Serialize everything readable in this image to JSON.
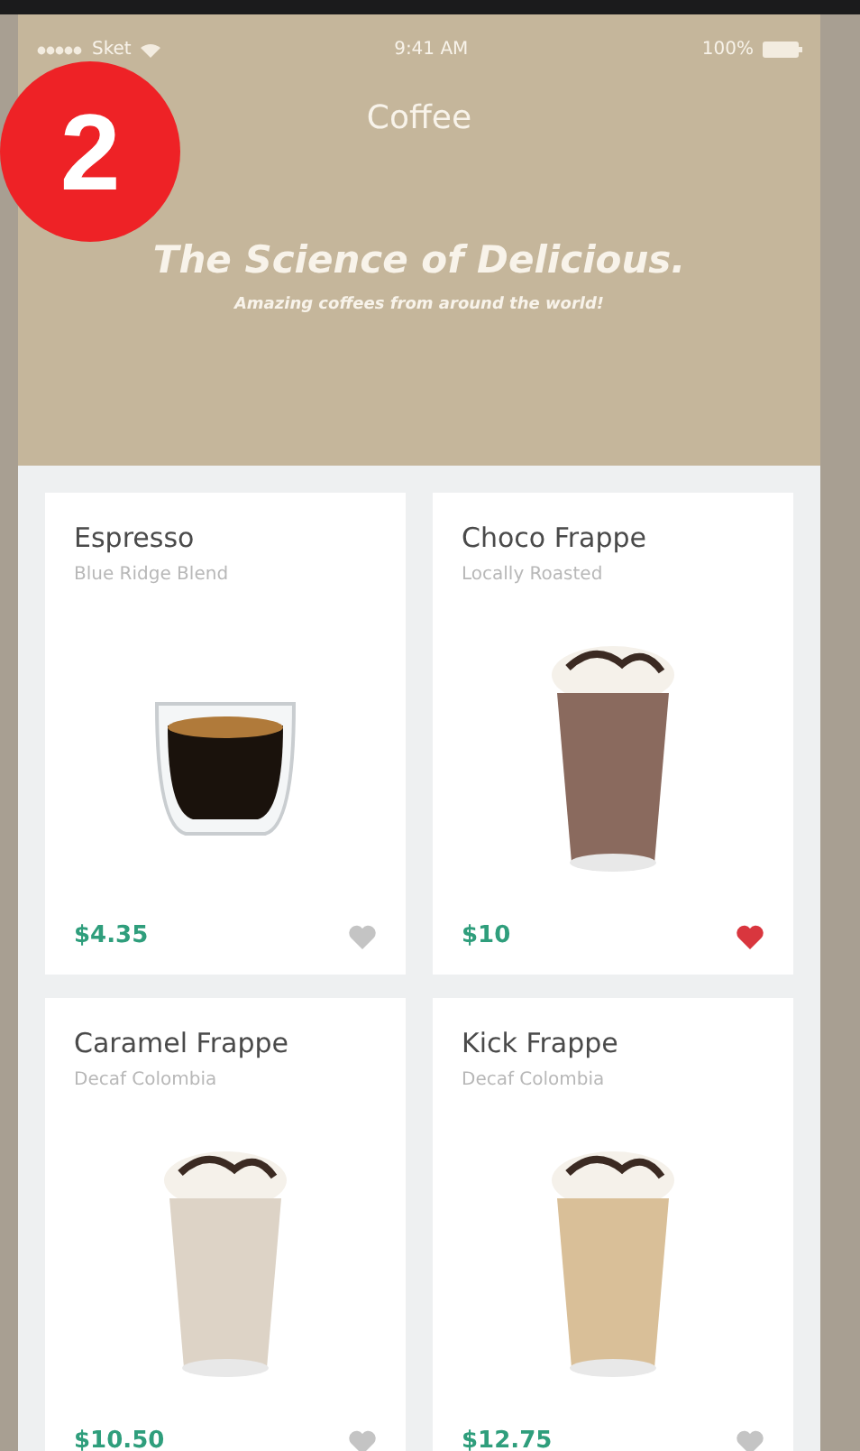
{
  "step_badge": "2",
  "status_bar": {
    "carrier": "Sket",
    "time": "9:41 AM",
    "battery": "100%"
  },
  "nav_title": "Coffee",
  "hero": {
    "title": "The Science of Delicious.",
    "subtitle": "Amazing coffees from around the world!"
  },
  "products": [
    {
      "name": "Espresso",
      "origin": "Blue Ridge Blend",
      "price": "$4.35",
      "favorite": false,
      "kind": "shot",
      "color": "#1a120c"
    },
    {
      "name": "Choco Frappe",
      "origin": "Locally Roasted",
      "price": "$10",
      "favorite": true,
      "kind": "frappe",
      "color": "#8a6a5e"
    },
    {
      "name": "Caramel Frappe",
      "origin": "Decaf Colombia",
      "price": "$10.50",
      "favorite": false,
      "kind": "frappe",
      "color": "#ddd3c6"
    },
    {
      "name": "Kick Frappe",
      "origin": "Decaf Colombia",
      "price": "$12.75",
      "favorite": false,
      "kind": "frappe",
      "color": "#d9bf98"
    }
  ]
}
